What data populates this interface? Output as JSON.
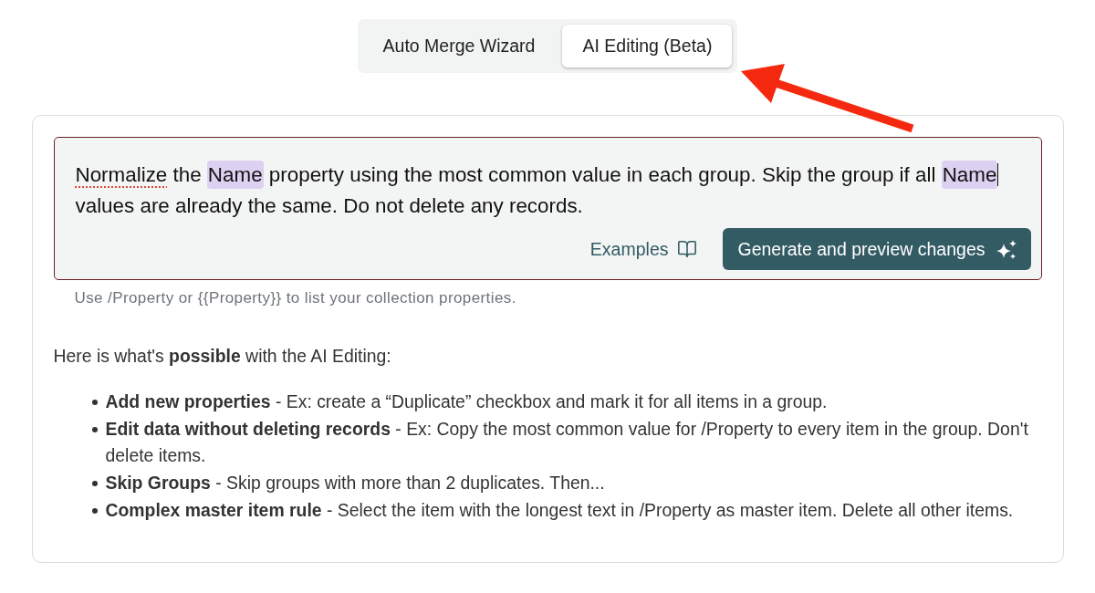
{
  "tabs": [
    {
      "label": "Auto Merge Wizard",
      "selected": false
    },
    {
      "label": "AI Editing (Beta)",
      "selected": true
    }
  ],
  "prompt": {
    "segments": [
      {
        "text": "Normalize",
        "kind": "misspelled"
      },
      {
        "text": " the ",
        "kind": "plain"
      },
      {
        "text": "Name",
        "kind": "property"
      },
      {
        "text": " property using the most common value in each group. Skip the group if all ",
        "kind": "plain"
      },
      {
        "text": "Name",
        "kind": "property"
      },
      {
        "kind": "caret"
      },
      {
        "text": " values are already the same. Do not delete any records.",
        "kind": "plain"
      }
    ],
    "examples_label": "Examples",
    "generate_label": "Generate and preview changes"
  },
  "hint": "Use /Property or {{Property}} to list your collection properties.",
  "intro": "Here is what's **possible** with the AI Editing:",
  "capabilities": [
    {
      "text": "**Add new properties** - Ex: create a “Duplicate” checkbox and mark it for all items in a group."
    },
    {
      "text": "**Edit data without deleting records** - Ex: Copy the most common value for /Property to every item in the group. Don't delete items."
    },
    {
      "text": "**Skip Groups** - Skip groups with more than 2 duplicates. Then..."
    },
    {
      "text": "**Complex master item rule** - Select the item with the longest text in /Property as master item. Delete all other items."
    }
  ]
}
